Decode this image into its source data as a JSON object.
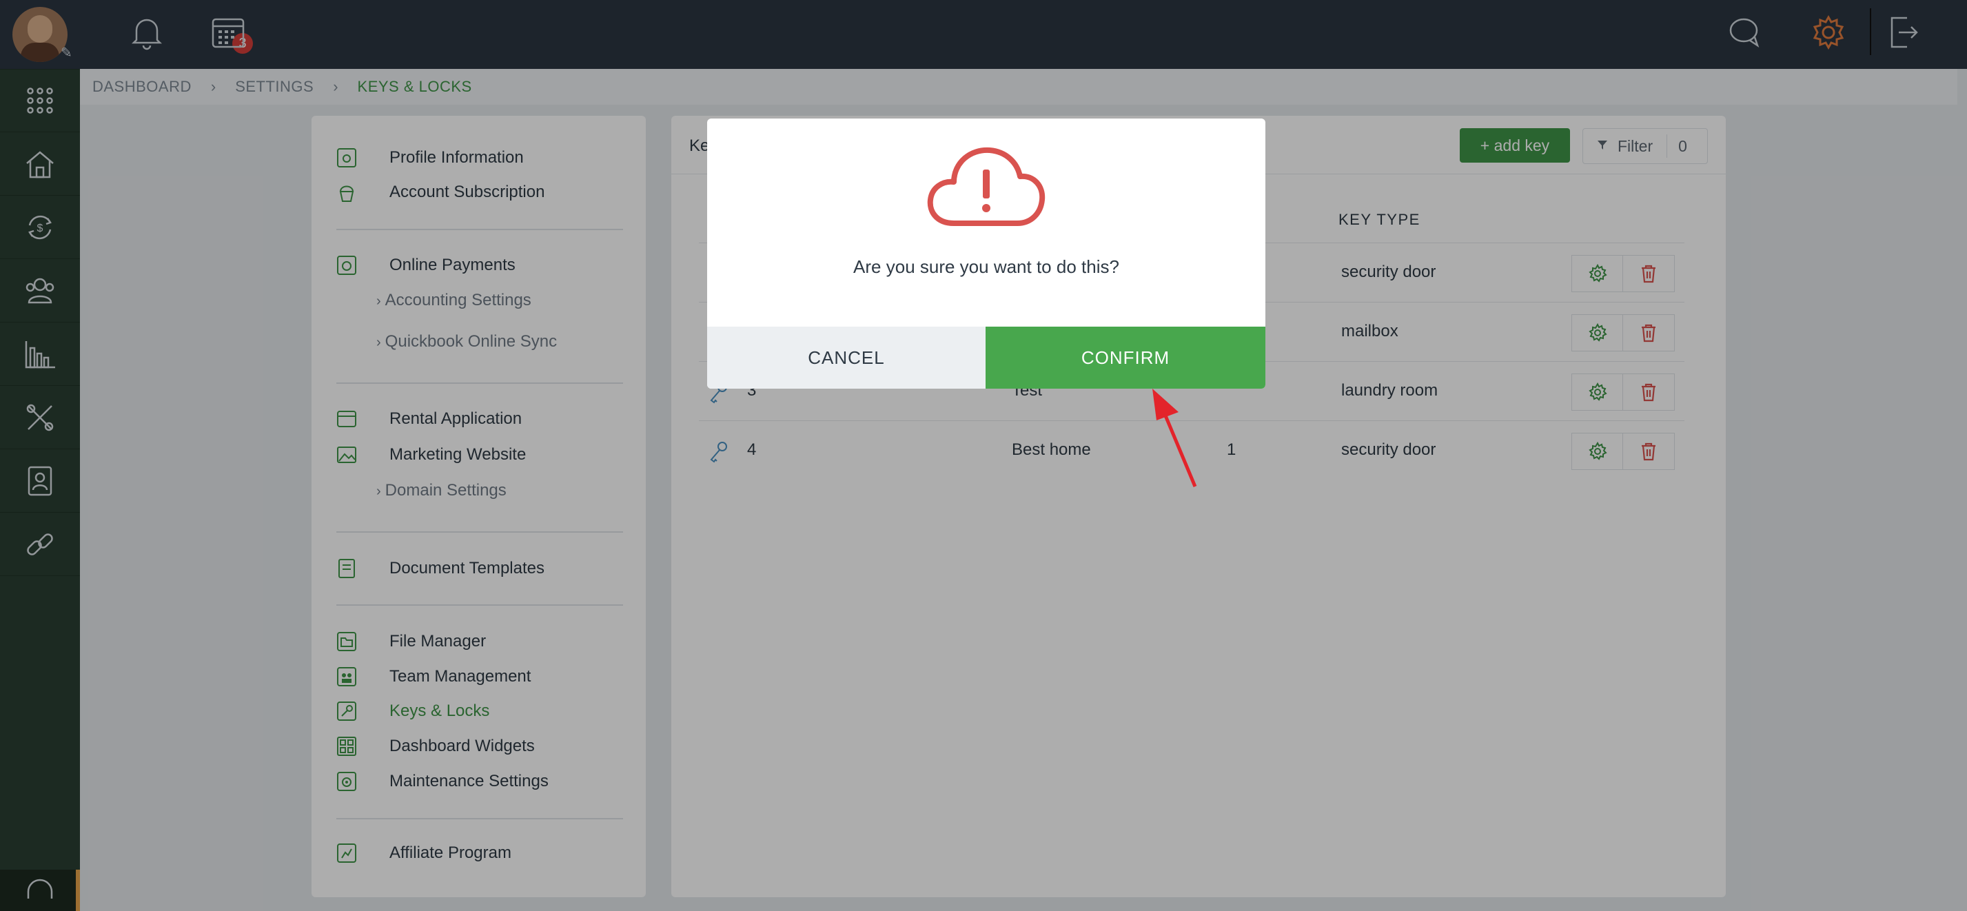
{
  "header": {
    "notification_count": "3"
  },
  "breadcrumb": [
    "DASHBOARD",
    "SETTINGS",
    "KEYS & LOCKS"
  ],
  "settings_menu": {
    "profile_information": "Profile Information",
    "account_subscription": "Account Subscription",
    "online_payments": "Online Payments",
    "accounting_settings": "Accounting Settings",
    "quickbook_sync": "Quickbook Online Sync",
    "rental_application": "Rental Application",
    "marketing_website": "Marketing Website",
    "domain_settings": "Domain Settings",
    "document_templates": "Document Templates",
    "file_manager": "File Manager",
    "team_management": "Team Management",
    "keys_locks": "Keys & Locks",
    "dashboard_widgets": "Dashboard Widgets",
    "maintenance_settings": "Maintenance Settings",
    "affiliate_program": "Affiliate Program"
  },
  "main": {
    "title_partial": "Ke",
    "add_key_label": "+ add key",
    "filter_label": "Filter",
    "filter_count": "0",
    "column_key_type": "KEY TYPE",
    "rows": [
      {
        "key_type": "security door"
      },
      {
        "key_type": "mailbox"
      },
      {
        "number": "3",
        "name": "Test",
        "key_type": "laundry room"
      },
      {
        "number": "4",
        "name": "Best home",
        "count": "1",
        "key_type": "security door"
      }
    ]
  },
  "modal": {
    "message": "Are you sure you want to do this?",
    "cancel_label": "CANCEL",
    "confirm_label": "CONFIRM"
  },
  "colors": {
    "brand_green": "#3f9447",
    "confirm_green": "#48a74d",
    "danger_red": "#d9534f",
    "sidebar": "#2a3f33",
    "header": "#2b3541"
  }
}
